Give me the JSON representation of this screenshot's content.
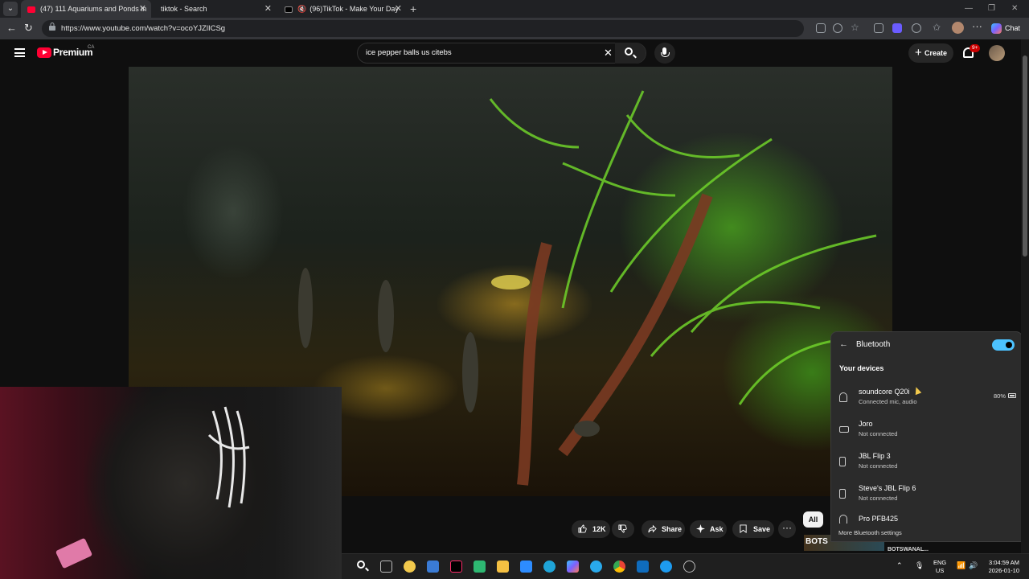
{
  "browser": {
    "tabs": [
      {
        "label": "(47) 111 Aquariums and Ponds in",
        "active": true,
        "favicon": "youtube-icon"
      },
      {
        "label": "tiktok - Search",
        "active": false,
        "favicon": "search-icon"
      },
      {
        "label": "(96)TikTok - Make Your Day",
        "active": false,
        "favicon": "tiktok-icon",
        "muted": true
      }
    ],
    "url": "https://www.youtube.com/watch?v=ocoYJZlICSg",
    "chat_label": "Chat"
  },
  "youtube": {
    "brand": "Premium",
    "country": "CA",
    "search_query": "ice pepper balls us citebs",
    "create_label": "Create",
    "notification_count": "9+",
    "actions": {
      "likes": "12K",
      "share": "Share",
      "ask": "Ask",
      "save": "Save",
      "more": "···"
    },
    "chip_all": "All",
    "thumb_label_left": "BOTS",
    "thumb_label_right": "BOTSWANAL..."
  },
  "bluetooth": {
    "title": "Bluetooth",
    "enabled": true,
    "section": "Your devices",
    "devices": [
      {
        "name": "soundcore Q20i",
        "status": "Connected mic, audio",
        "battery": "80%",
        "icon": "headphones-icon"
      },
      {
        "name": "Joro",
        "status": "Not connected",
        "icon": "keyboard-icon"
      },
      {
        "name": "JBL Flip 3",
        "status": "Not connected",
        "icon": "speaker-icon"
      },
      {
        "name": "Steve's JBL Flip 6",
        "status": "Not connected",
        "icon": "speaker-icon"
      },
      {
        "name": "Pro PFB425",
        "status": "",
        "icon": "headphones-icon"
      }
    ],
    "more_settings": "More Bluetooth settings"
  },
  "taskbar": {
    "language": "ENG",
    "region": "US",
    "time": "3:04:59 AM",
    "date": "2026-01-10"
  },
  "colors": {
    "yt_red": "#ff0033",
    "bt_accent": "#4cc2ff",
    "bg": "#0f0f0f"
  }
}
